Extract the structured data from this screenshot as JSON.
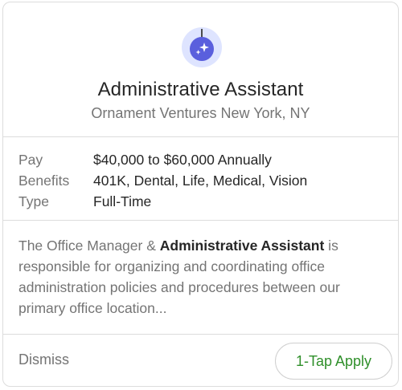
{
  "job": {
    "title": "Administrative Assistant",
    "company_location": "Ornament Ventures New York, NY"
  },
  "details": {
    "pay_label": "Pay",
    "pay_value": "$40,000 to $60,000 Annually",
    "benefits_label": "Benefits",
    "benefits_value": "401K, Dental, Life, Medical, Vision",
    "type_label": "Type",
    "type_value": "Full-Time"
  },
  "description": {
    "prefix": "The Office Manager & ",
    "highlight": "Administrative Assistant",
    "suffix": " is responsible for organizing and coordinating office administration policies and procedures between our primary office location..."
  },
  "actions": {
    "dismiss_label": "Dismiss",
    "apply_label": "1-Tap Apply"
  },
  "icons": {
    "logo": "ornament-sparkle-icon"
  },
  "colors": {
    "logo_background": "#dee4ff",
    "logo_ornament": "#5a5fdd",
    "apply_text": "#2f8f2a"
  }
}
